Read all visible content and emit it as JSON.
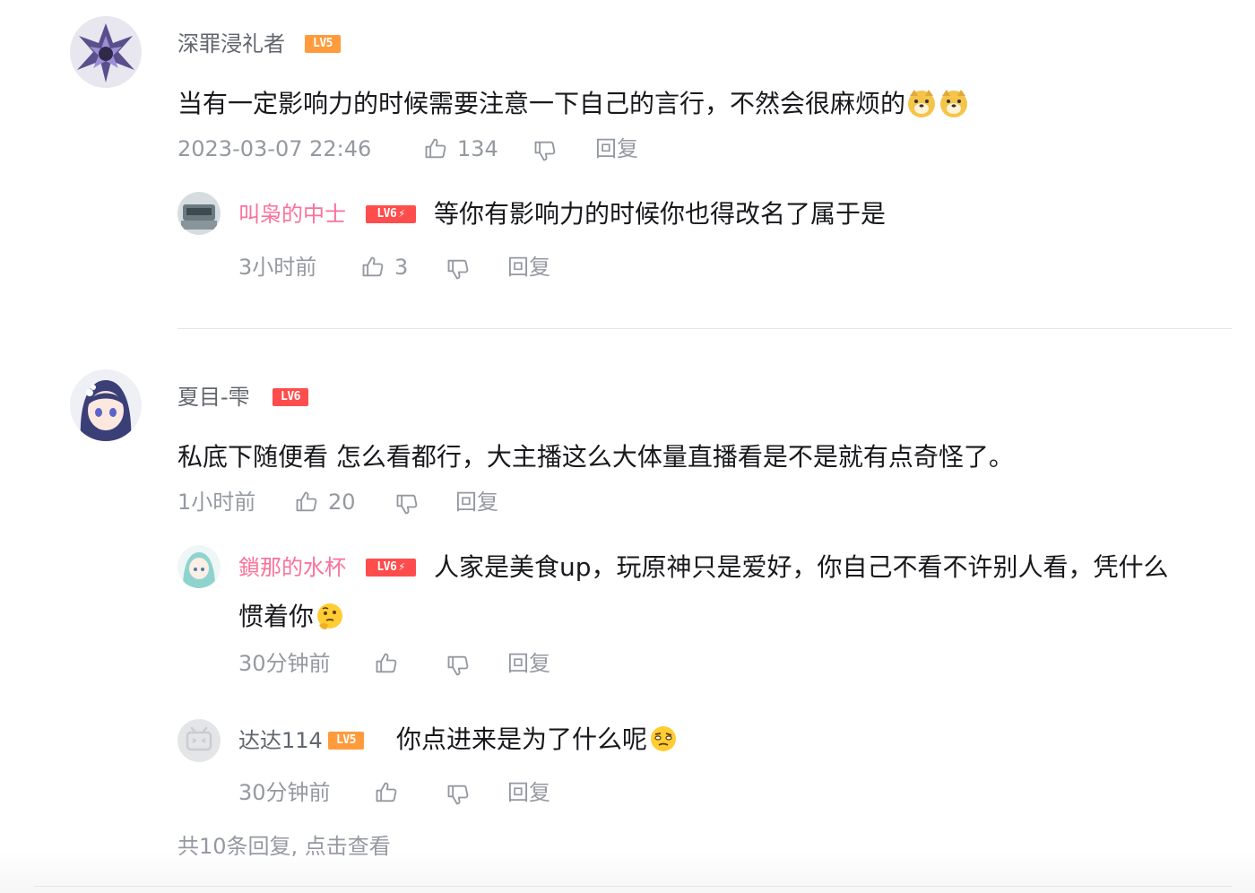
{
  "comments": [
    {
      "username": "深罪浸礼者",
      "level": "LV5",
      "text": "当有一定影响力的时候需要注意一下自己的言行，不然会很麻烦的",
      "emojis": [
        "doge-icon",
        "doge-icon"
      ],
      "time": "2023-03-07 22:46",
      "likes": "134",
      "reply_label": "回复",
      "replies": [
        {
          "username": "叫枭的中士",
          "level": "LV6",
          "text": "等你有影响力的时候你也得改名了属于是",
          "time": "3小时前",
          "likes": "3",
          "reply_label": "回复"
        }
      ]
    },
    {
      "username": "夏目-雫",
      "level": "LV6",
      "text": "私底下随便看 怎么看都行，大主播这么大体量直播看是不是就有点奇怪了。",
      "time": "1小时前",
      "likes": "20",
      "reply_label": "回复",
      "replies": [
        {
          "username": "鎖那的水杯",
          "level": "LV6",
          "text_line1": "人家是美食up，玩原神只是爱好，你自己不看不许别人看，凭什么",
          "text_line2": "惯着你",
          "emoji": "thinking-face-icon",
          "time": "30分钟前",
          "reply_label": "回复"
        },
        {
          "username": "达达114",
          "level": "LV5",
          "text": "你点进来是为了什么呢",
          "emoji": "doubt-face-icon",
          "time": "30分钟前",
          "reply_label": "回复"
        }
      ],
      "more_replies": "共10条回复, 点击查看"
    }
  ],
  "colors": {
    "vip_name": "#fb7299",
    "lv5": "#ff9b3c",
    "lv6": "#ff4c4c",
    "meta": "#9499a0"
  }
}
